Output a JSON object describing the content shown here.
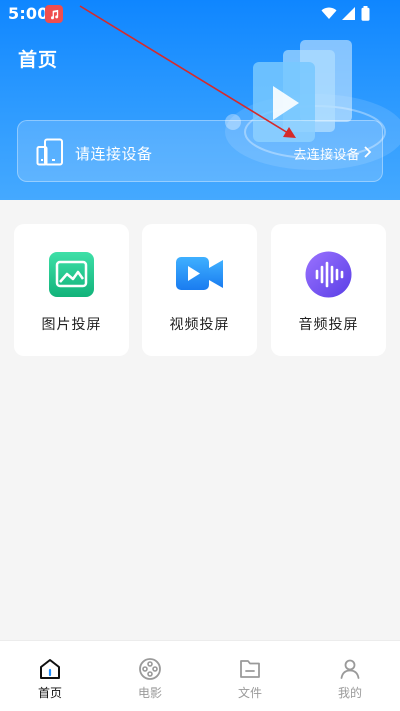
{
  "status_bar": {
    "time": "5:00",
    "icons": [
      "music-notification-icon",
      "wifi-icon",
      "signal-icon",
      "battery-icon"
    ]
  },
  "header": {
    "title": "首页"
  },
  "connect_card": {
    "status_text": "请连接设备",
    "action_label": "去连接设备",
    "icon": "device-icon"
  },
  "features": [
    {
      "label": "图片投屏",
      "icon": "image-icon",
      "color": "#22c38e"
    },
    {
      "label": "视频投屏",
      "icon": "video-camera-icon",
      "color": "#1f8fff"
    },
    {
      "label": "音频投屏",
      "icon": "audio-wave-icon",
      "color": "#7b5bf5"
    }
  ],
  "bottom_nav": {
    "items": [
      {
        "label": "首页",
        "icon": "home-icon",
        "active": true
      },
      {
        "label": "电影",
        "icon": "film-reel-icon",
        "active": false
      },
      {
        "label": "文件",
        "icon": "folder-icon",
        "active": false
      },
      {
        "label": "我的",
        "icon": "user-icon",
        "active": false
      }
    ]
  },
  "colors": {
    "header_blue": "#0f86ff",
    "background": "#f5f5f5",
    "annotation_arrow": "#d62a2a"
  }
}
